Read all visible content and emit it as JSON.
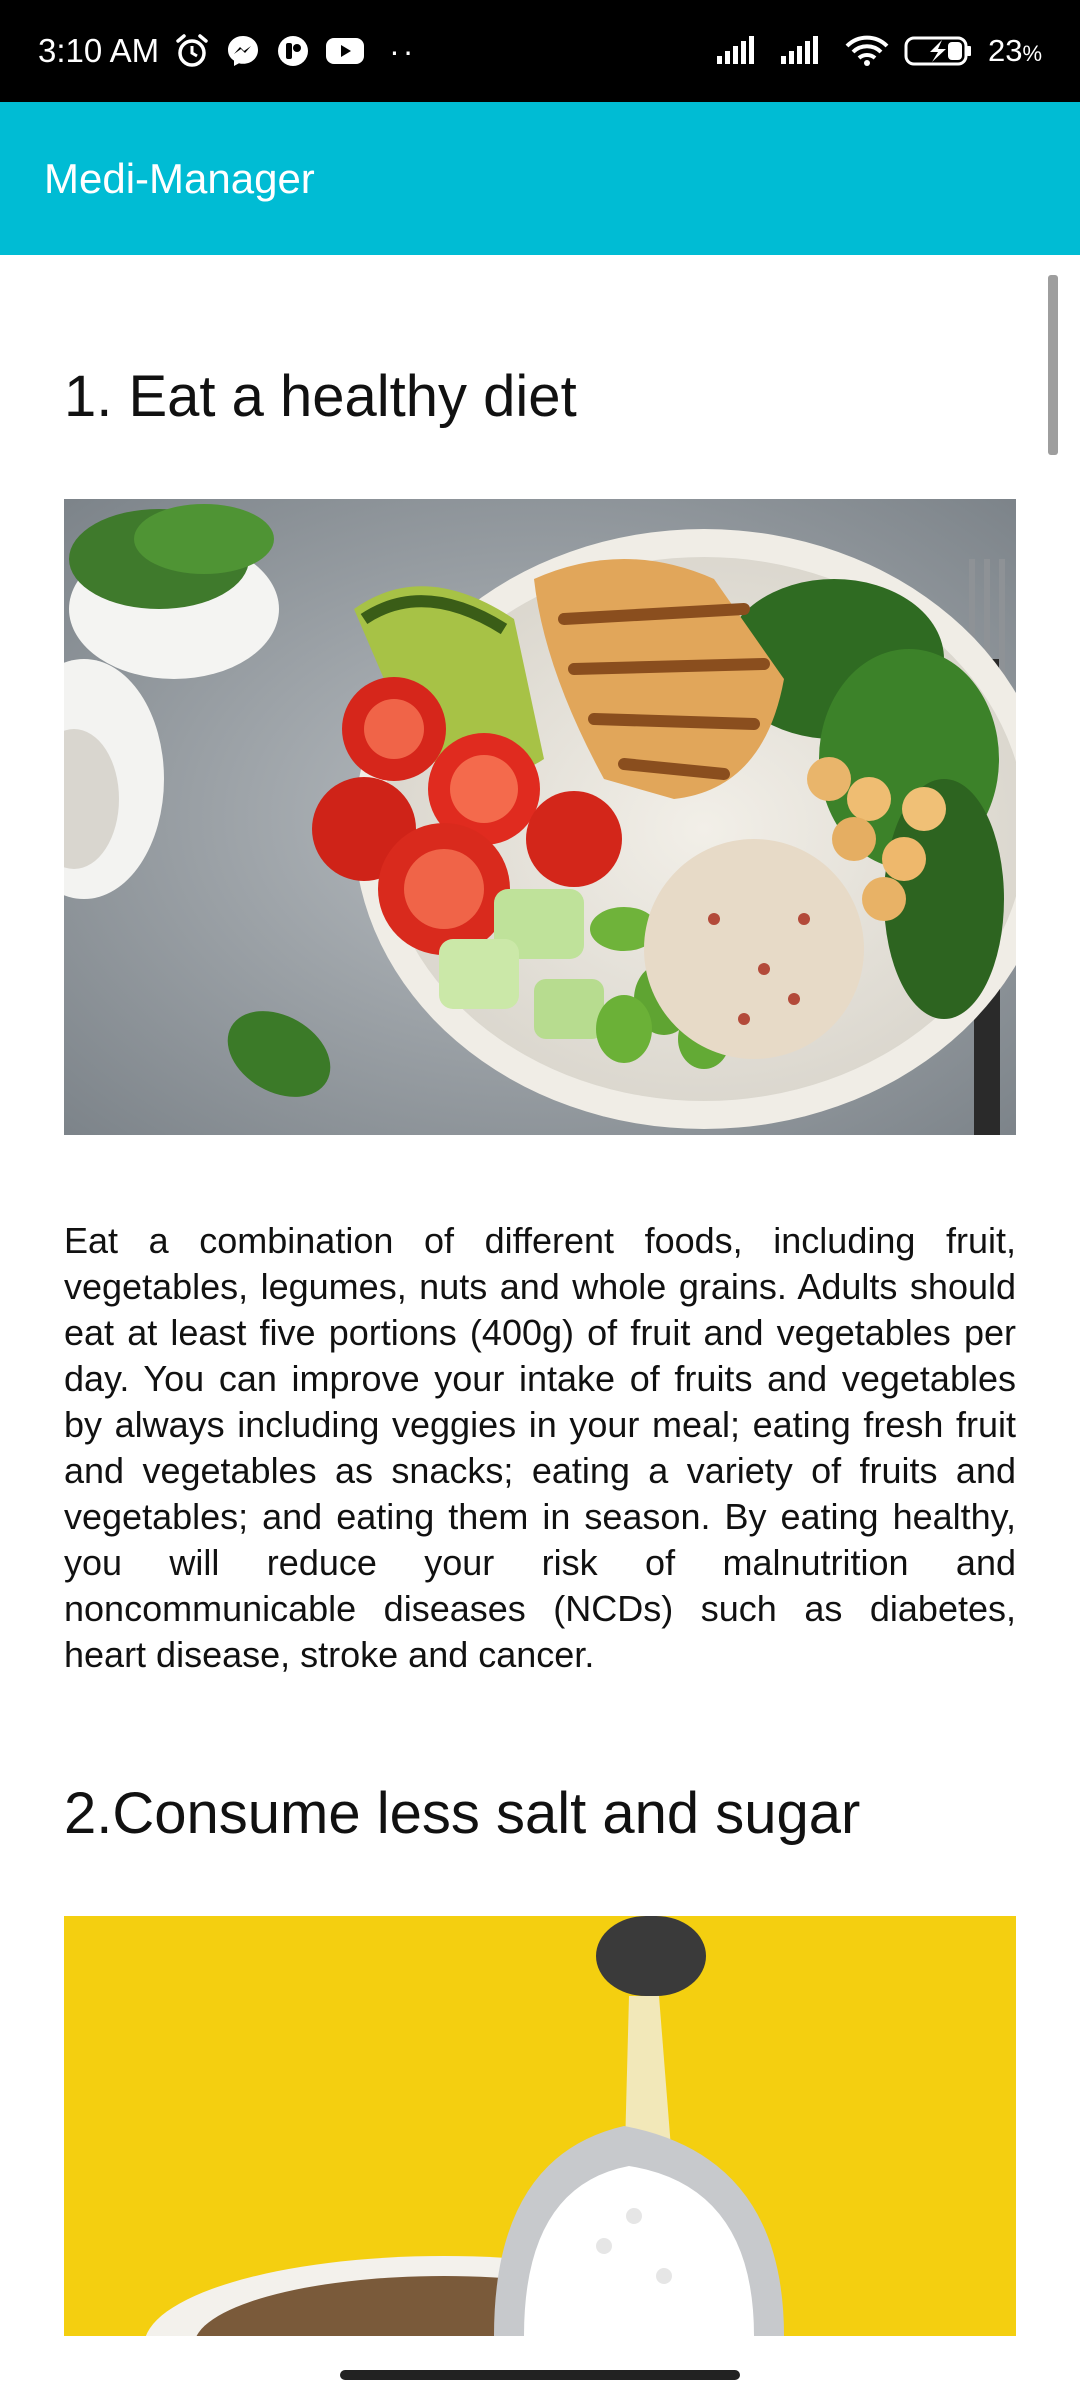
{
  "status_bar": {
    "time": "3:10 AM",
    "battery": "23",
    "battery_unit": "%",
    "left_icons": [
      "alarm-icon",
      "messenger-icon",
      "app-notification-icon",
      "youtube-icon"
    ],
    "more_notifications": "··",
    "right_icons": [
      "signal-icon",
      "signal-icon",
      "wifi-icon",
      "battery-charging-icon"
    ]
  },
  "app_bar": {
    "title": "Medi-Manager",
    "background": "#00bcd4"
  },
  "article": {
    "sections": [
      {
        "heading": "1. Eat a healthy diet",
        "image": "healthy-food-bowl-image",
        "body": "Eat a combination of different foods, including fruit, vegetables, legumes, nuts and whole grains. Adults should eat at least five portions (400g) of fruit and vegetables per day. You can improve your intake of fruits and vegetables by always including veggies in your meal; eating fresh fruit and vegetables as snacks; eating a variety of fruits and vegetables; and eating them in season. By eating healthy, you will reduce your risk of malnutrition and noncommunicable diseases (NCDs) such as diabetes, heart disease, stroke and cancer."
      },
      {
        "heading": "2.Consume less salt and sugar",
        "image": "sugar-spoon-image"
      }
    ]
  }
}
